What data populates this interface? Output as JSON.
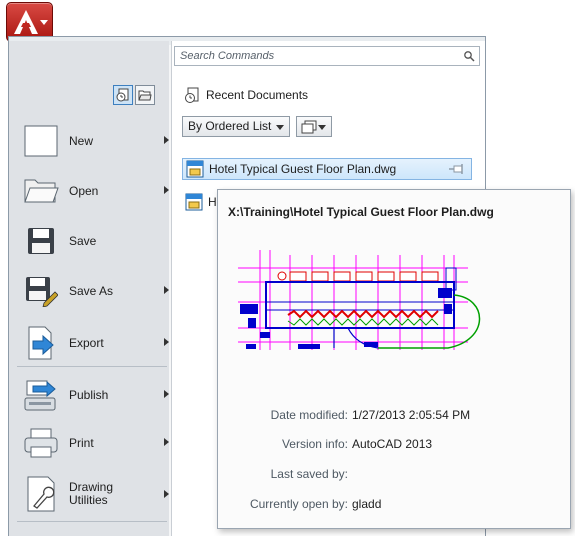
{
  "app_button": {
    "icon": "autocad-logo-icon"
  },
  "view_toggle": {
    "recent_icon": "recent-documents-icon",
    "open_icon": "open-documents-icon"
  },
  "left_menu": {
    "items": [
      {
        "label": "New",
        "icon": "new-file-icon",
        "submenu": true
      },
      {
        "label": "Open",
        "icon": "open-folder-icon",
        "submenu": true
      },
      {
        "label": "Save",
        "icon": "save-disk-icon",
        "submenu": false
      },
      {
        "label": "Save As",
        "icon": "save-as-icon",
        "submenu": true
      },
      {
        "label": "Export",
        "icon": "export-icon",
        "submenu": true
      },
      {
        "label": "Publish",
        "icon": "publish-icon",
        "submenu": true
      },
      {
        "label": "Print",
        "icon": "printer-icon",
        "submenu": true
      },
      {
        "label": "Drawing Utilities",
        "icon": "wrench-icon",
        "submenu": true
      }
    ]
  },
  "search": {
    "placeholder": "Search Commands"
  },
  "recent": {
    "title": "Recent Documents",
    "sort_label": "By Ordered List",
    "files": [
      {
        "name": "Hotel Typical Guest Floor Plan.dwg",
        "selected": true
      },
      {
        "name": "H",
        "selected": false
      }
    ]
  },
  "tooltip": {
    "path": "X:\\Training\\Hotel Typical Guest Floor Plan.dwg",
    "details": [
      {
        "label": "Date modified:",
        "value": "1/27/2013 2:05:54 PM"
      },
      {
        "label": "Version info:",
        "value": "AutoCAD 2013"
      },
      {
        "label": "Last saved by:",
        "value": ""
      },
      {
        "label": "Currently open by:",
        "value": "gladd"
      }
    ]
  },
  "colors": {
    "accent": "#3d7fbf",
    "app_red": "#c0261f",
    "thumb_magenta": "#ff00ff",
    "thumb_blue": "#0000cc",
    "thumb_red": "#e00000",
    "thumb_green": "#00a000"
  }
}
